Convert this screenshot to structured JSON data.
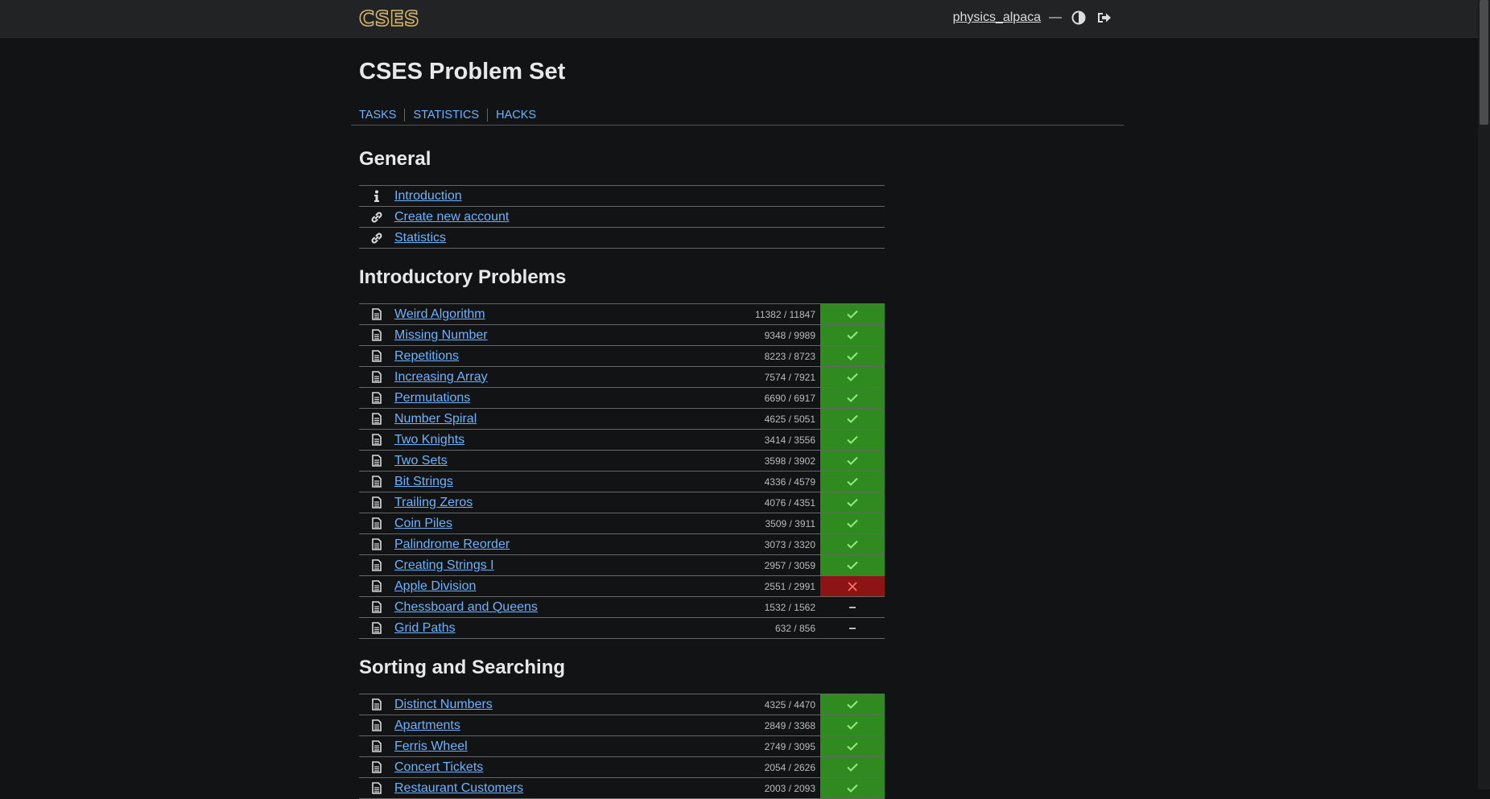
{
  "header": {
    "logo_text": "CSES",
    "username": "physics_alpaca",
    "dash": "—"
  },
  "page_title": "CSES Problem Set",
  "nav": [
    {
      "label": "TASKS"
    },
    {
      "label": "STATISTICS"
    },
    {
      "label": "HACKS"
    }
  ],
  "sections": {
    "general": {
      "title": "General",
      "items": [
        {
          "icon": "info-icon",
          "label": "Introduction"
        },
        {
          "icon": "link-icon",
          "label": "Create new account"
        },
        {
          "icon": "link-icon",
          "label": "Statistics"
        }
      ]
    },
    "intro": {
      "title": "Introductory Problems",
      "items": [
        {
          "label": "Weird Algorithm",
          "count": "11382 / 11847",
          "status": "solved"
        },
        {
          "label": "Missing Number",
          "count": "9348 / 9989",
          "status": "solved"
        },
        {
          "label": "Repetitions",
          "count": "8223 / 8723",
          "status": "solved"
        },
        {
          "label": "Increasing Array",
          "count": "7574 / 7921",
          "status": "solved"
        },
        {
          "label": "Permutations",
          "count": "6690 / 6917",
          "status": "solved"
        },
        {
          "label": "Number Spiral",
          "count": "4625 / 5051",
          "status": "solved"
        },
        {
          "label": "Two Knights",
          "count": "3414 / 3556",
          "status": "solved"
        },
        {
          "label": "Two Sets",
          "count": "3598 / 3902",
          "status": "solved"
        },
        {
          "label": "Bit Strings",
          "count": "4336 / 4579",
          "status": "solved"
        },
        {
          "label": "Trailing Zeros",
          "count": "4076 / 4351",
          "status": "solved"
        },
        {
          "label": "Coin Piles",
          "count": "3509 / 3911",
          "status": "solved"
        },
        {
          "label": "Palindrome Reorder",
          "count": "3073 / 3320",
          "status": "solved"
        },
        {
          "label": "Creating Strings I",
          "count": "2957 / 3059",
          "status": "solved"
        },
        {
          "label": "Apple Division",
          "count": "2551 / 2991",
          "status": "failed"
        },
        {
          "label": "Chessboard and Queens",
          "count": "1532 / 1562",
          "status": "none"
        },
        {
          "label": "Grid Paths",
          "count": "632 / 856",
          "status": "none"
        }
      ]
    },
    "sorting": {
      "title": "Sorting and Searching",
      "items": [
        {
          "label": "Distinct Numbers",
          "count": "4325 / 4470",
          "status": "solved"
        },
        {
          "label": "Apartments",
          "count": "2849 / 3368",
          "status": "solved"
        },
        {
          "label": "Ferris Wheel",
          "count": "2749 / 3095",
          "status": "solved"
        },
        {
          "label": "Concert Tickets",
          "count": "2054 / 2626",
          "status": "solved"
        },
        {
          "label": "Restaurant Customers",
          "count": "2003 / 2093",
          "status": "solved"
        }
      ]
    }
  },
  "status_glyphs": {
    "solved": "✓",
    "failed": "✕",
    "none": "–"
  },
  "colors": {
    "solved": "#2f8a20",
    "failed": "#8c1414",
    "link": "#6db3ff",
    "check": "#8cf07a",
    "cross": "#ff6b6b"
  }
}
